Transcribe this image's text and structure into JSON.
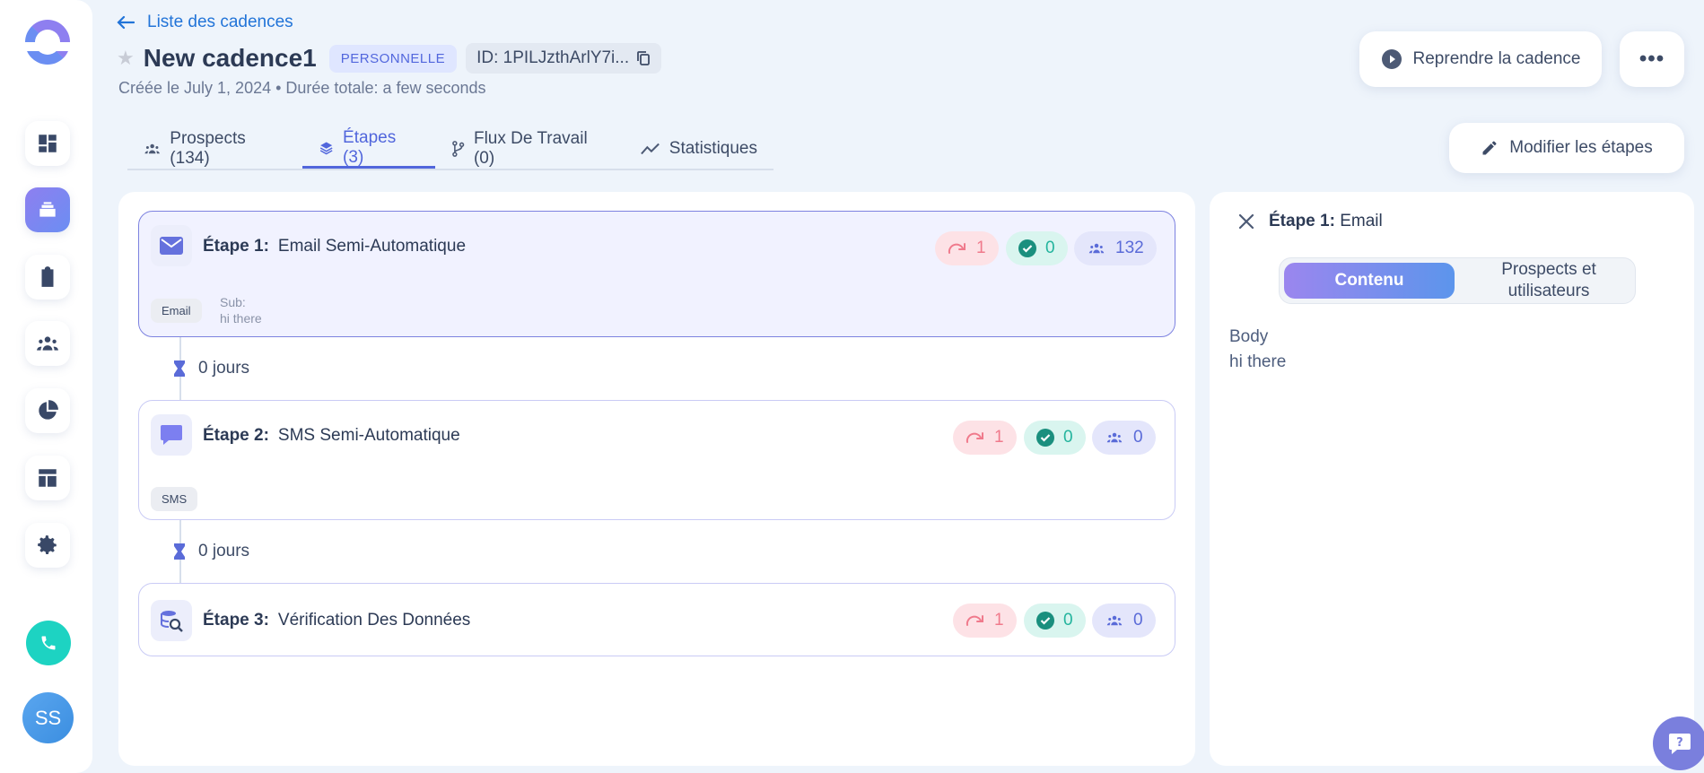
{
  "header": {
    "back_label": "Liste des cadences",
    "title": "New cadence1",
    "type_badge": "PERSONNELLE",
    "id_label": "ID: 1PILJzthArlY7i...",
    "subtitle": "Créée le July 1, 2024 • Durée totale: a few seconds",
    "resume_label": "Reprendre la cadence",
    "edit_steps_label": "Modifier les étapes"
  },
  "tabs": [
    {
      "label": "Prospects (134)",
      "icon": "users-icon"
    },
    {
      "label": "Étapes (3)",
      "icon": "layers-icon"
    },
    {
      "label": "Flux De Travail (0)",
      "icon": "workflow-icon"
    },
    {
      "label": "Statistiques",
      "icon": "chart-line-icon"
    }
  ],
  "steps": [
    {
      "prefix": "Étape 1:",
      "name": "Email Semi-Automatique",
      "icon": "envelope-icon",
      "skipped": "1",
      "completed": "0",
      "prospects": "132",
      "type_tag": "Email",
      "sub_label": "Sub:",
      "sub_value": "hi there"
    },
    {
      "prefix": "Étape 2:",
      "name": "SMS Semi-Automatique",
      "icon": "message-icon",
      "skipped": "1",
      "completed": "0",
      "prospects": "0",
      "type_tag": "SMS"
    },
    {
      "prefix": "Étape 3:",
      "name": "Vérification Des Données",
      "icon": "data-check-icon",
      "skipped": "1",
      "completed": "0",
      "prospects": "0"
    }
  ],
  "delays": [
    "0 jours",
    "0 jours"
  ],
  "detail": {
    "prefix": "Étape 1:",
    "name": "Email",
    "tab_content": "Contenu",
    "tab_prospects": "Prospects et utilisateurs",
    "body_label": "Body",
    "body_value": "hi there"
  },
  "user": {
    "initials": "SS"
  },
  "colors": {
    "accent": "#5166dc",
    "link": "#2274d8",
    "red_pill": "#f07a8c",
    "green_pill": "#23b49d",
    "teal_phone": "#1dd3c2"
  }
}
